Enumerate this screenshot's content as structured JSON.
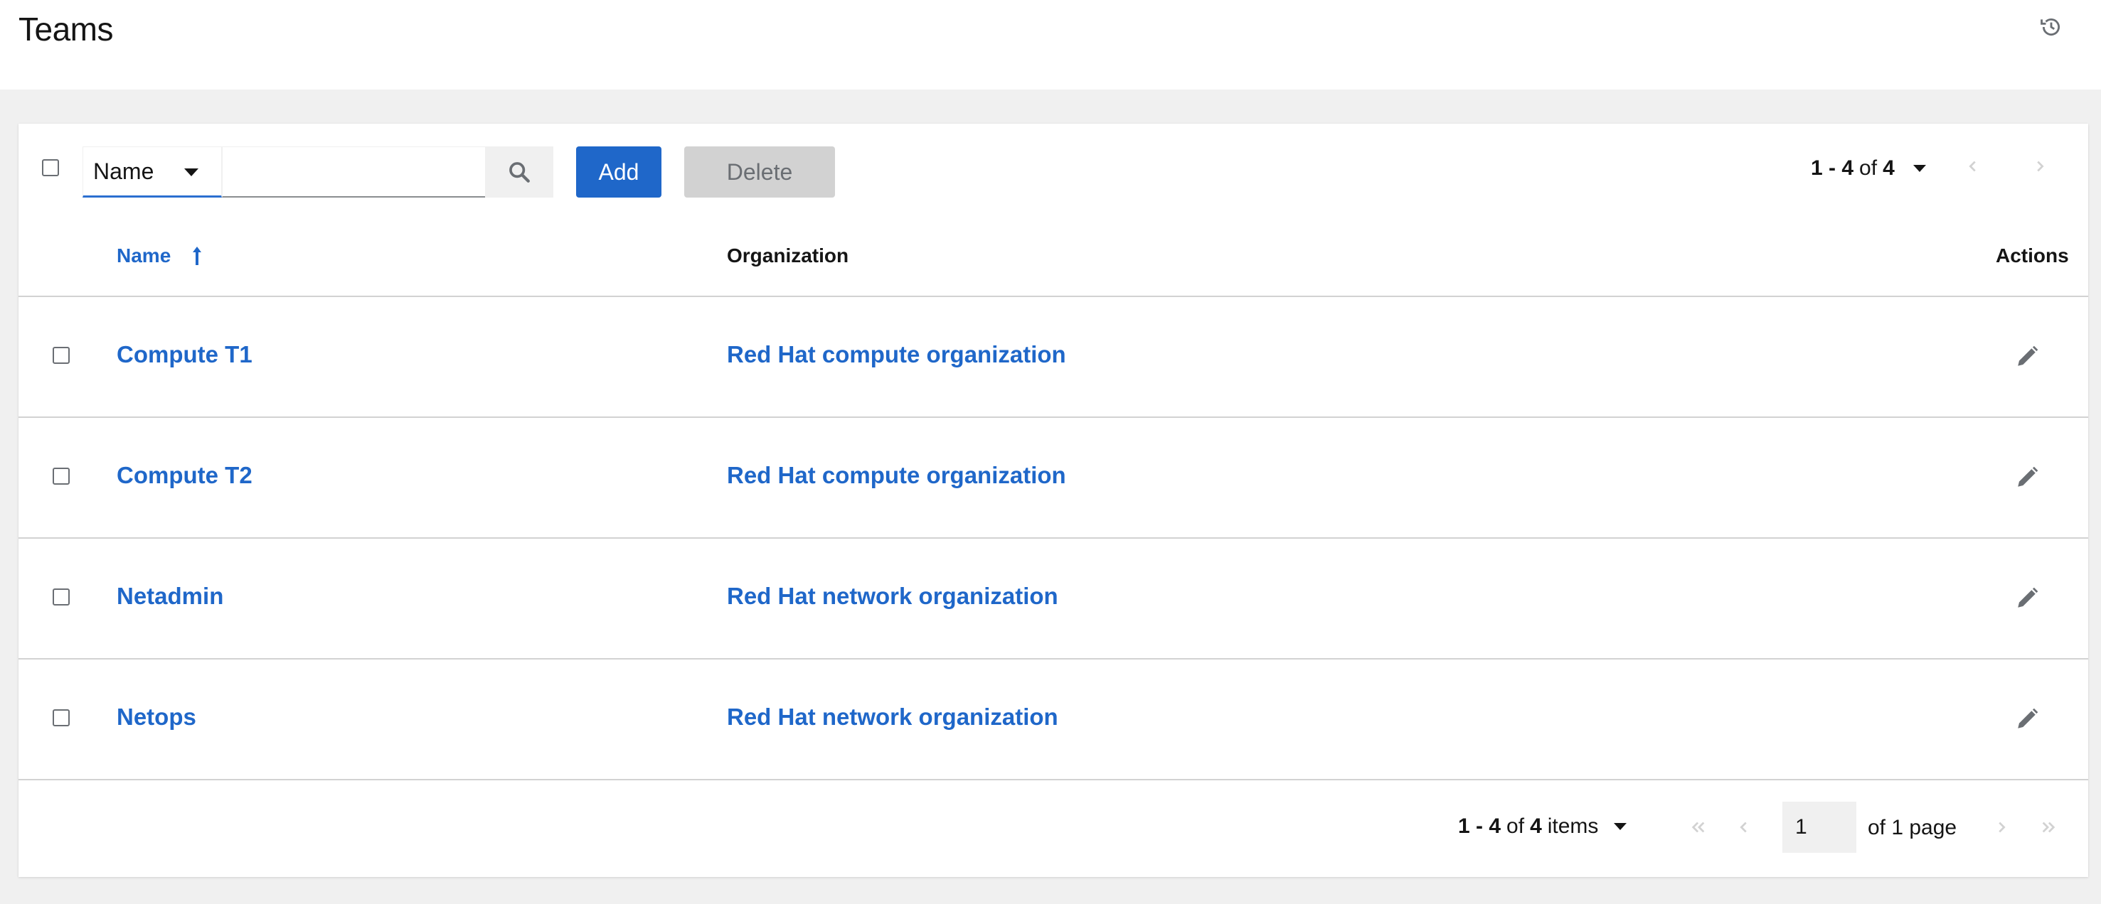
{
  "header": {
    "title": "Teams",
    "history_icon": "history-icon"
  },
  "toolbar": {
    "filter_field": "Name",
    "search_value": "",
    "search_icon": "search-icon",
    "add_label": "Add",
    "delete_label": "Delete",
    "range": "1 - 4",
    "of_word": "of",
    "total": "4"
  },
  "table": {
    "columns": [
      "Name",
      "Organization",
      "Actions"
    ],
    "sort_icon": "sort-ascending-icon",
    "rows": [
      {
        "name": "Compute T1",
        "organization": "Red Hat compute organization"
      },
      {
        "name": "Compute T2",
        "organization": "Red Hat compute organization"
      },
      {
        "name": "Netadmin",
        "organization": "Red Hat network organization"
      },
      {
        "name": "Netops",
        "organization": "Red Hat network organization"
      }
    ],
    "edit_icon": "pencil-icon"
  },
  "pagination": {
    "range": "1 - 4",
    "of_word": "of",
    "total": "4",
    "items_word": "items",
    "current_page": "1",
    "of_pages": "of 1 page"
  },
  "colors": {
    "accent": "#1f67c9",
    "background": "#f0f0f0",
    "border": "#d2d2d2",
    "disabled": "#d2d2d2"
  }
}
